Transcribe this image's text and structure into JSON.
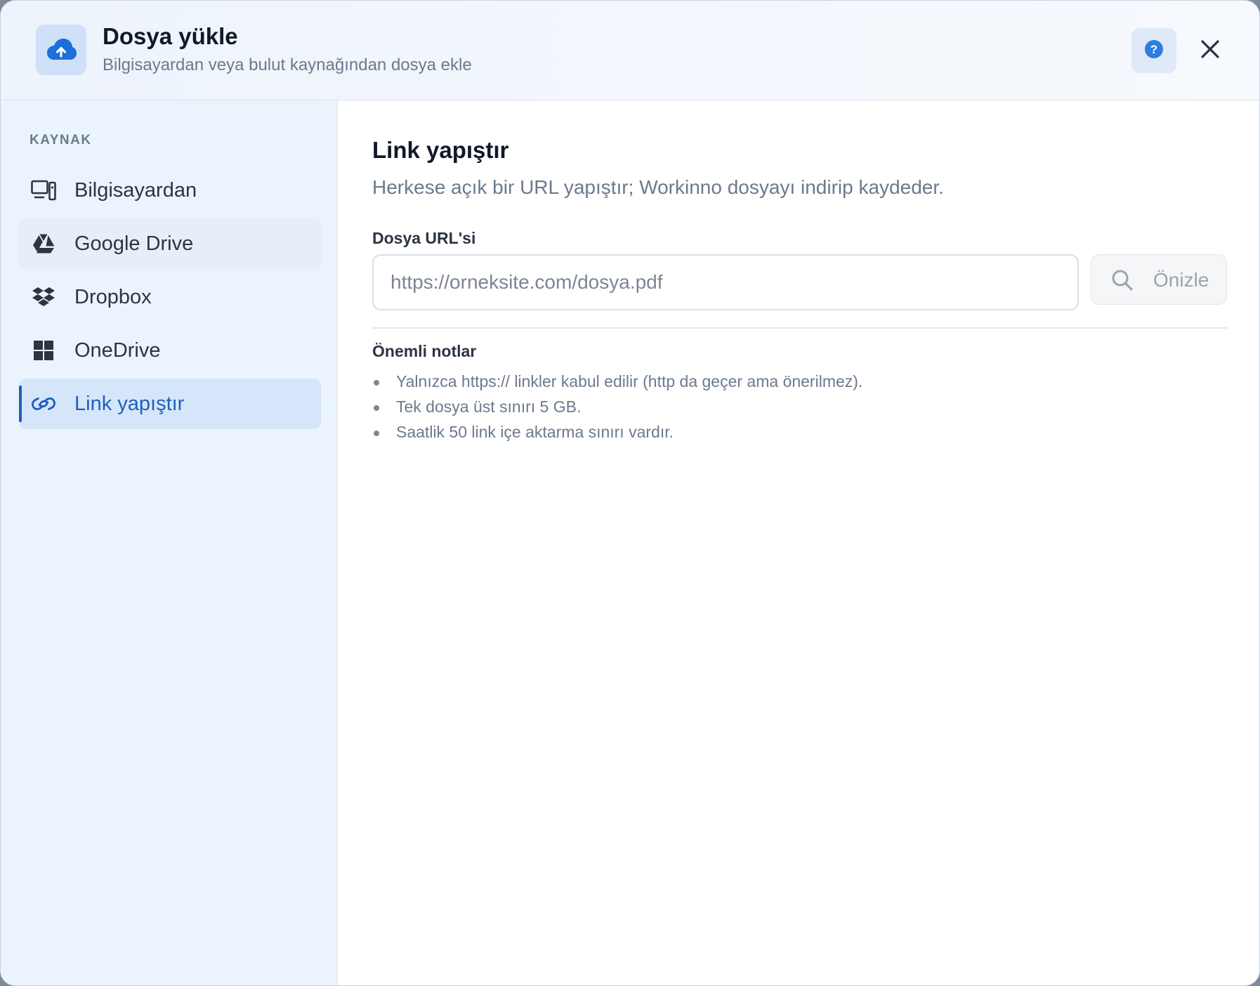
{
  "header": {
    "title": "Dosya yükle",
    "subtitle": "Bilgisayardan veya bulut kaynağından dosya ekle",
    "icon": "cloud-upload-icon",
    "help_icon": "help-circle-icon",
    "close_icon": "close-icon"
  },
  "sidebar": {
    "heading": "KAYNAK",
    "items": [
      {
        "label": "Bilgisayardan",
        "icon": "computer-icon",
        "state": "default"
      },
      {
        "label": "Google Drive",
        "icon": "google-drive-icon",
        "state": "hover"
      },
      {
        "label": "Dropbox",
        "icon": "dropbox-icon",
        "state": "default"
      },
      {
        "label": "OneDrive",
        "icon": "onedrive-icon",
        "state": "default"
      },
      {
        "label": "Link yapıştır",
        "icon": "link-icon",
        "state": "active"
      }
    ]
  },
  "main": {
    "title": "Link yapıştır",
    "description": "Herkese açık bir URL yapıştır; Workinno dosyayı indirip kaydeder.",
    "url_field": {
      "label": "Dosya URL'si",
      "value": "",
      "placeholder": "https://orneksite.com/dosya.pdf"
    },
    "preview_button": {
      "label": "Önizle",
      "icon": "search-icon",
      "enabled": false
    },
    "notes": {
      "title": "Önemli notlar",
      "items": [
        "Yalnızca https:// linkler kabul edilir (http da geçer ama önerilmez).",
        "Tek dosya üst sınırı 5 GB.",
        "Saatlik 50 link içe aktarma sınırı vardır."
      ]
    }
  },
  "colors": {
    "accent": "#1f5fbf",
    "sidebar_bg": "#ebf4fd",
    "active_item_bg": "#d6e6fa",
    "muted_text": "#6b7a8c"
  }
}
